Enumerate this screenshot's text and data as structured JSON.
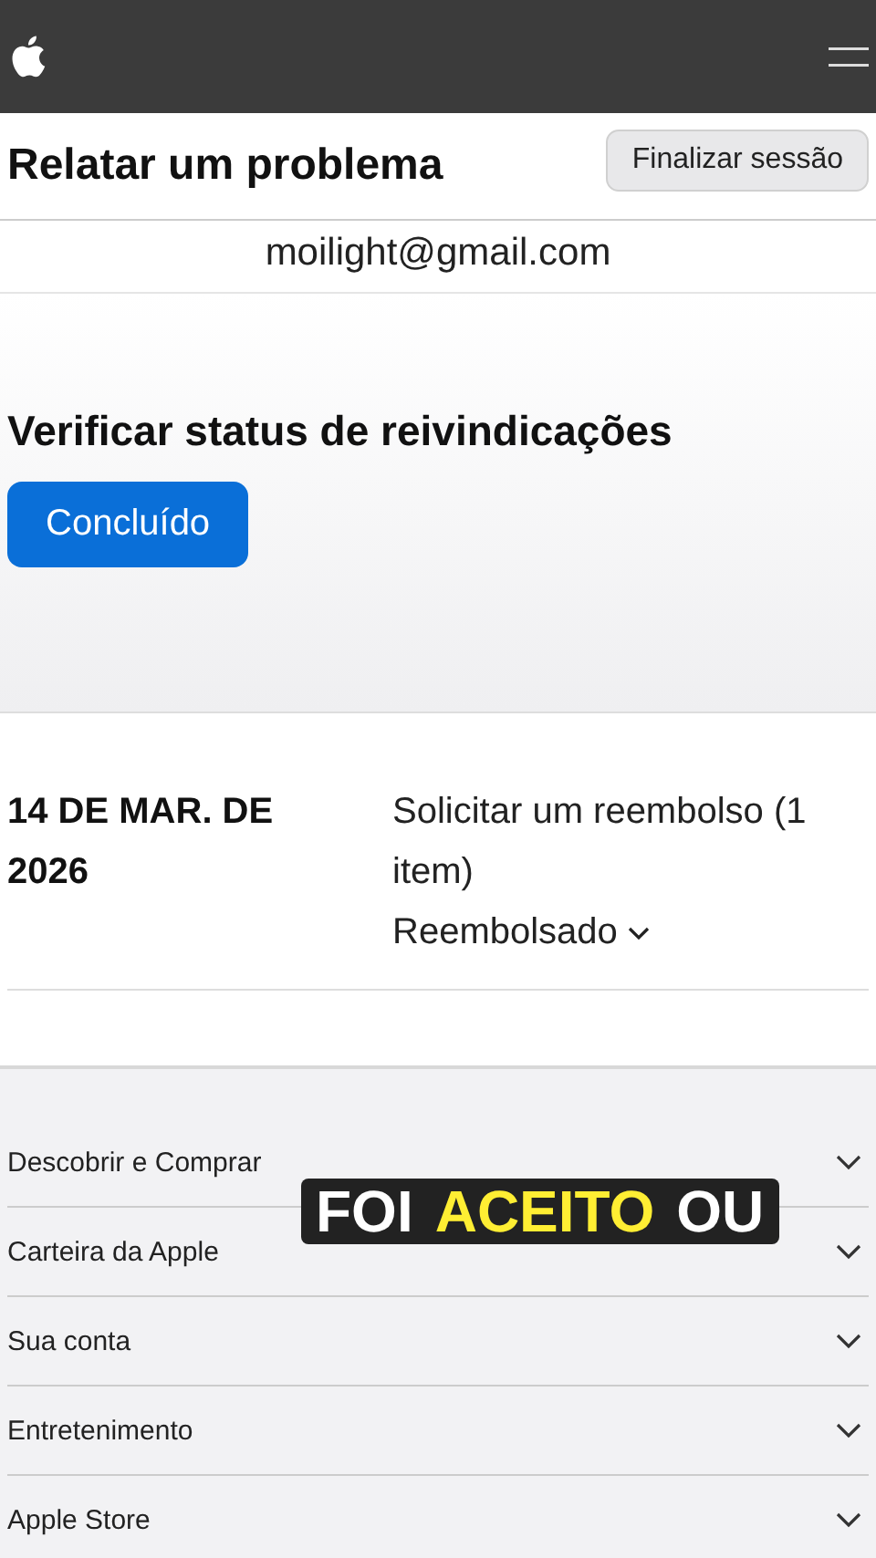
{
  "header": {
    "title": "Relatar um problema",
    "button": "Finalizar sessão"
  },
  "account": {
    "email": "moilight@gmail.com"
  },
  "claims": {
    "title": "Verificar status de reivindicações",
    "button": "Concluído"
  },
  "claim": {
    "date": "14 DE MAR. DE 2026",
    "description": "Solicitar um reembolso (1 item)",
    "status": "Reembolsado",
    "expanded": false
  },
  "footer": {
    "items": [
      {
        "label": "Descobrir e Comprar",
        "expanded": false
      },
      {
        "label": "Carteira da Apple",
        "expanded": false
      },
      {
        "label": "Sua conta",
        "expanded": false
      },
      {
        "label": "Entretenimento",
        "expanded": false
      },
      {
        "label": "Apple Store",
        "expanded": false
      }
    ]
  },
  "caption": {
    "words": [
      {
        "text": "FOI",
        "highlighted": false
      },
      {
        "text": "ACEITO",
        "highlighted": true
      },
      {
        "text": "OU",
        "highlighted": false
      }
    ]
  }
}
